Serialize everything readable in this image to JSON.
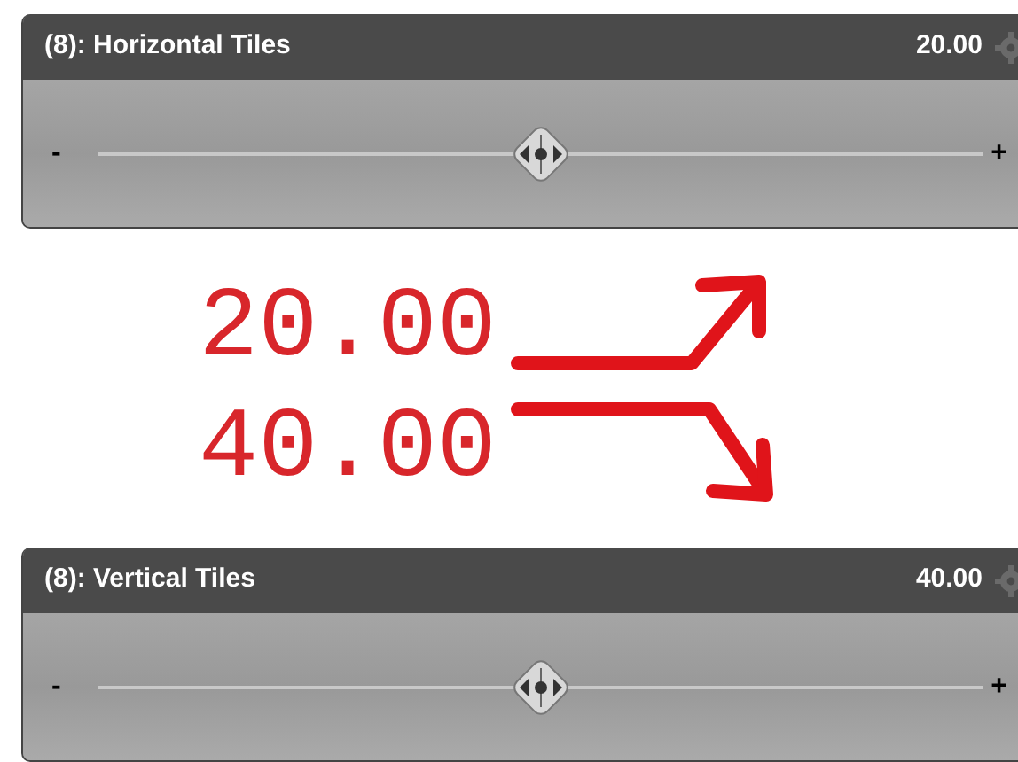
{
  "sliders": [
    {
      "label": "(8): Horizontal Tiles",
      "value": "20.00",
      "level": 0.5,
      "minus": "-",
      "plus": "+"
    },
    {
      "label": "(8): Vertical Tiles",
      "value": "40.00",
      "level": 0.5,
      "minus": "-",
      "plus": "+"
    }
  ],
  "annotations": [
    {
      "text": "20.00",
      "kind": "up"
    },
    {
      "text": "40.00",
      "kind": "down"
    }
  ]
}
